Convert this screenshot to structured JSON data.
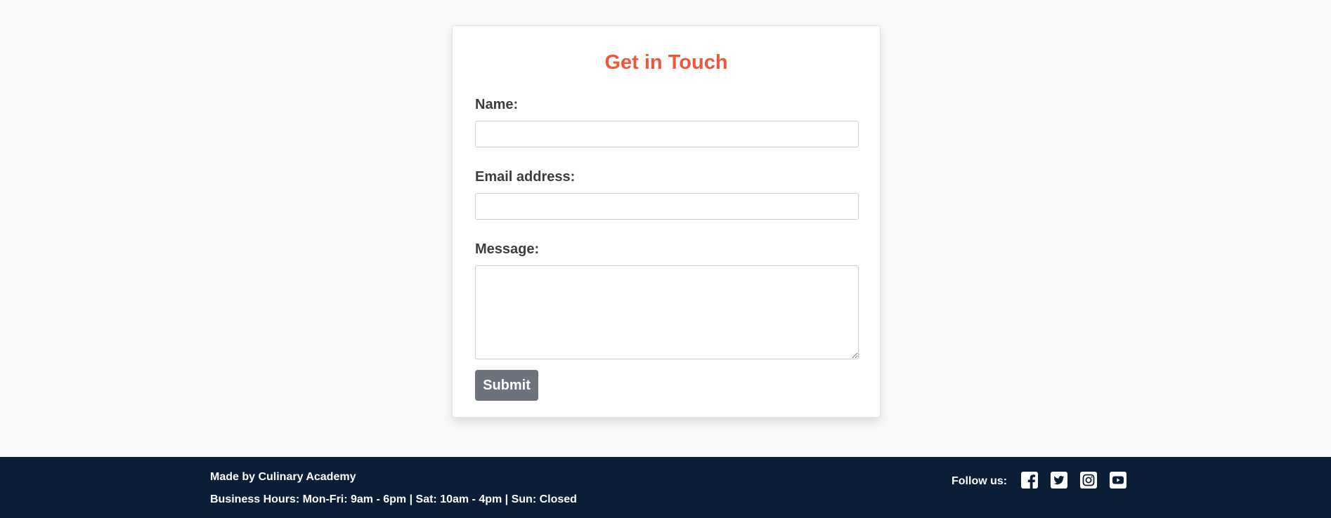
{
  "contact_form": {
    "title": "Get in Touch",
    "name_label": "Name:",
    "name_value": "",
    "email_label": "Email address:",
    "email_value": "",
    "message_label": "Message:",
    "message_value": "",
    "submit_label": "Submit"
  },
  "footer": {
    "made_by": "Made by Culinary Academy",
    "business_hours": "Business Hours: Mon-Fri: 9am - 6pm | Sat: 10am - 4pm | Sun: Closed",
    "follow_label": "Follow us:",
    "social_icons": [
      "facebook-icon",
      "twitter-icon",
      "instagram-icon",
      "youtube-icon"
    ]
  },
  "colors": {
    "page_background": "#f8f9fb",
    "accent": "#f1563a",
    "button": "#6c737c",
    "footer_background": "#0a1e37"
  }
}
